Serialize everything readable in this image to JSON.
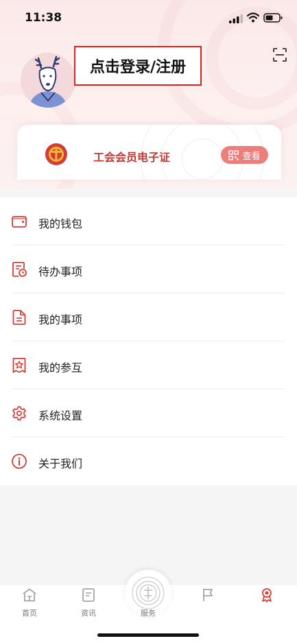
{
  "status_bar": {
    "time": "11:38"
  },
  "profile": {
    "login_label": "点击登录/注册"
  },
  "member_card": {
    "title": "工会会员电子证",
    "view_label": "查看"
  },
  "menu": {
    "items": [
      {
        "label": "我的钱包",
        "icon": "wallet-icon"
      },
      {
        "label": "待办事项",
        "icon": "todo-clock-icon"
      },
      {
        "label": "我的事项",
        "icon": "document-icon"
      },
      {
        "label": "我的参互",
        "icon": "star-badge-icon"
      },
      {
        "label": "系统设置",
        "icon": "gear-icon"
      },
      {
        "label": "关于我们",
        "icon": "info-icon"
      }
    ]
  },
  "tabbar": {
    "items": [
      {
        "label": "首页",
        "icon": "home-icon"
      },
      {
        "label": "资讯",
        "icon": "news-icon"
      },
      {
        "label": "服务",
        "icon": "service-icon"
      },
      {
        "label": "",
        "icon": "flag-icon"
      },
      {
        "label": "",
        "icon": "profile-medal-icon"
      }
    ]
  },
  "colors": {
    "accent": "#d23d36",
    "accent_light": "#ec7e7c",
    "header_bg": "#fbe9e9"
  }
}
